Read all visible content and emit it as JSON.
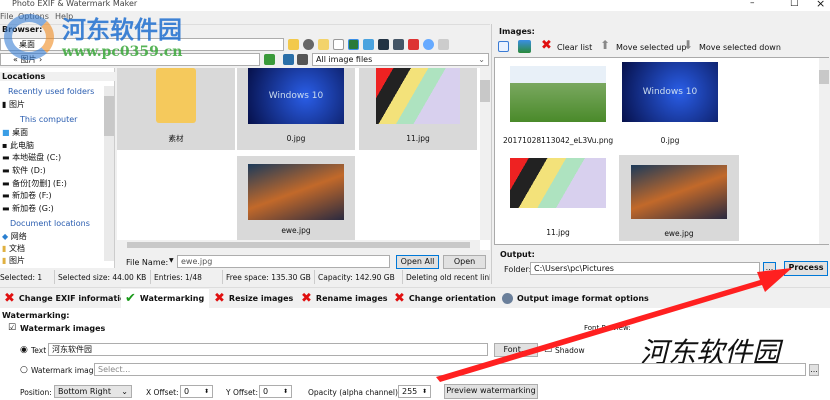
{
  "window": {
    "title": "Photo EXIF & Watermark Maker",
    "min": "–",
    "max": "□",
    "close": "×"
  },
  "menu": [
    "File",
    "Options",
    "Help"
  ],
  "logo": {
    "text": "河东软件园",
    "url": "www.pc0359.cn"
  },
  "browser": {
    "label": "Browser:",
    "path": "桌面",
    "breadcrumb": "« 图片 ›",
    "filter": "All image files"
  },
  "locations": {
    "header": "Locations",
    "recent": "Recently used folders",
    "recent_items": [
      "图片"
    ],
    "computer": "This computer",
    "computer_items": [
      "桌面",
      "此电脑",
      "本地磁盘 (C:)",
      "软件 (D:)",
      "备份[勿删] (E:)",
      "新加卷 (F:)",
      "新加卷 (G:)"
    ],
    "docs": "Document locations",
    "doc_items": [
      "网络",
      "文档",
      "图片"
    ]
  },
  "files": [
    {
      "name": "素材",
      "type": "folder"
    },
    {
      "name": "0.jpg",
      "type": "win"
    },
    {
      "name": "11.jpg",
      "type": "phone"
    },
    {
      "name": "ewe.jpg",
      "type": "game"
    }
  ],
  "filename": {
    "label": "File Name:",
    "value": "ewe.jpg",
    "open_all": "Open All",
    "open": "Open"
  },
  "status": [
    "Selected: 1",
    "Selected size: 44.00 KB",
    "Entries: 1/48",
    "Free space: 135.30 GB",
    "Capacity: 142.90 GB",
    "Deleting old recent link f"
  ],
  "images": {
    "label": "Images:",
    "clear": "Clear list",
    "up": "Move selected up",
    "down": "Move selected down",
    "items": [
      {
        "name": "20171028113042_eL3Vu.png",
        "type": "photo"
      },
      {
        "name": "0.jpg",
        "type": "win"
      },
      {
        "name": "11.jpg",
        "type": "phone"
      },
      {
        "name": "ewe.jpg",
        "type": "game"
      }
    ]
  },
  "output": {
    "label": "Output:",
    "folder_label": "Folder:",
    "folder": "C:\\Users\\pc\\Pictures",
    "browse": "...",
    "process": "Process"
  },
  "tabs": [
    "Change EXIF information",
    "Watermarking",
    "Resize images",
    "Rename images",
    "Change orientation",
    "Output image format options"
  ],
  "wm": {
    "section": "Watermarking:",
    "enable": "Watermark images",
    "text_label": "Text",
    "text_value": "河东软件园",
    "font_btn": "Font...",
    "shadow": "Shadow",
    "font_preview": "Font Preview:",
    "preview_text": "河东软件园",
    "image_label": "Watermark image",
    "image_placeholder": "Select...",
    "browse": "...",
    "position_label": "Position:",
    "position": "Bottom Right",
    "xoff_label": "X Offset:",
    "xoff": "0",
    "yoff_label": "Y Offset:",
    "yoff": "0",
    "opacity_label": "Opacity (alpha channel):",
    "opacity": "255",
    "preview_btn": "Preview watermarking"
  },
  "colors": {
    "accent": "#0078d7",
    "x": "#e01010",
    "check": "#1a9a1a",
    "arrow": "#ff2020"
  }
}
